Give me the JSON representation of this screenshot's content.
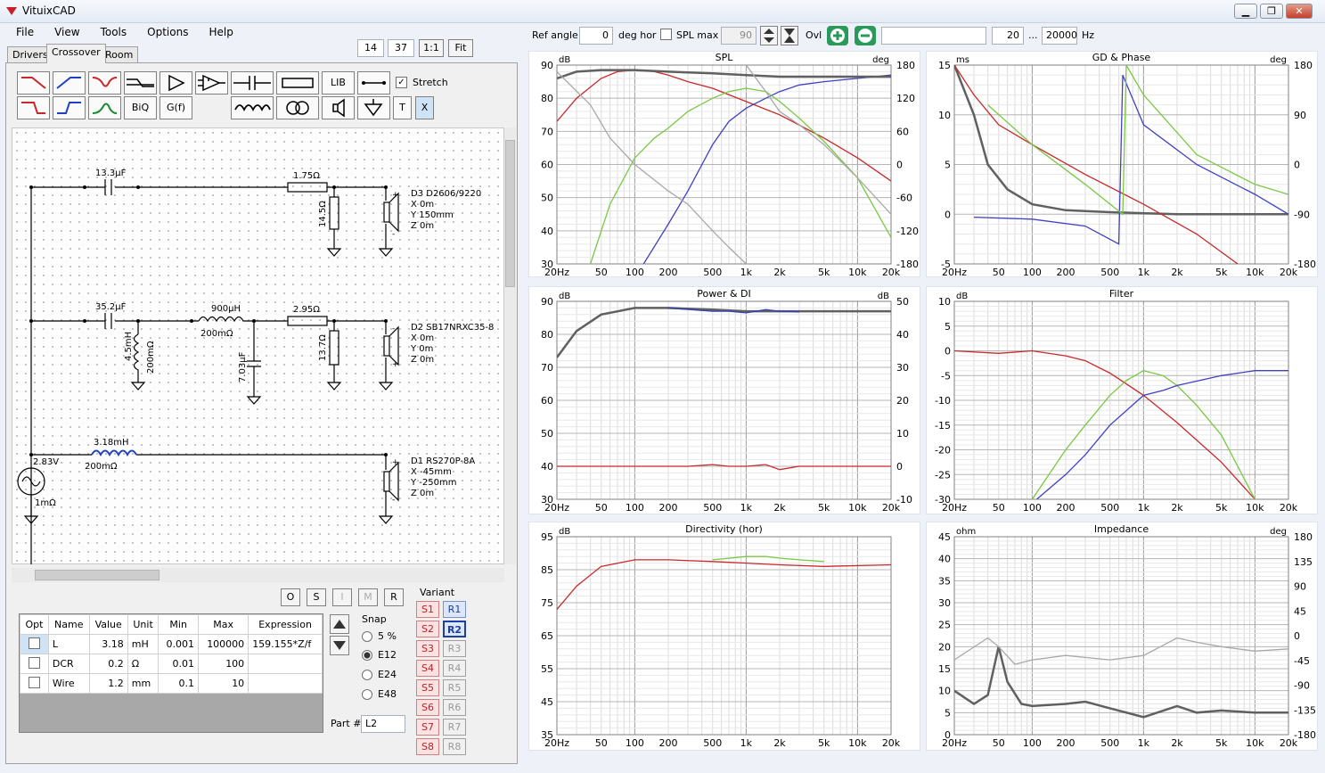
{
  "window": {
    "title": "VituixCAD",
    "minimize": "▁",
    "restore": "❐",
    "close": "✕"
  },
  "menu": [
    "File",
    "View",
    "Tools",
    "Options",
    "Help"
  ],
  "tabs": [
    "Drivers",
    "Crossover",
    "Room"
  ],
  "top_inputs": {
    "a": "14",
    "b": "37",
    "one_to_one": "1:1",
    "fit": "Fit"
  },
  "toolbar": {
    "lib": "LIB",
    "stretch": "Stretch",
    "biq": "BiQ",
    "gf": "G(f)",
    "t": "T",
    "x": "X"
  },
  "schematic": {
    "labels": {
      "c1": "13.3µF",
      "r1": "1.75Ω",
      "r2": "14.5Ω",
      "d3": "D3 D2606/9220",
      "d3x": "X 0m",
      "d3y": "Y 150mm",
      "d3z": "Z 0m",
      "c2": "35.2µF",
      "l1": "900µH",
      "l1r": "200mΩ",
      "r3": "2.95Ω",
      "l2": "4.5mH",
      "l2r": "200mΩ",
      "c3": "7.03µF",
      "r4": "13.7Ω",
      "d2": "D2 SB17NRXC35-8",
      "d2x": "X 0m",
      "d2y": "Y 0m",
      "d2z": "Z 0m",
      "l3": "3.18mH",
      "l3r": "200mΩ",
      "src": "2.83V",
      "srcr": "1mΩ",
      "d1": "D1 RS270P-8A",
      "d1x": "X -45mm",
      "d1y": "Y -250mm",
      "d1z": "Z 0m"
    }
  },
  "osimr": [
    "O",
    "S",
    "I",
    "M",
    "R"
  ],
  "params": {
    "headers": [
      "Opt",
      "Name",
      "Value",
      "Unit",
      "Min",
      "Max",
      "Expression"
    ],
    "rows": [
      {
        "name": "L",
        "value": "3.18",
        "unit": "mH",
        "min": "0.001",
        "max": "100000",
        "expr": "159.155*Z/f"
      },
      {
        "name": "DCR",
        "value": "0.2",
        "unit": "Ω",
        "min": "0.01",
        "max": "100",
        "expr": ""
      },
      {
        "name": "Wire",
        "value": "1.2",
        "unit": "mm",
        "min": "0.1",
        "max": "10",
        "expr": ""
      }
    ]
  },
  "snap": {
    "title": "Snap",
    "options": [
      "5 %",
      "E12",
      "E24",
      "E48"
    ],
    "selected": "E12",
    "part_label": "Part #",
    "part_value": "L2"
  },
  "variant": {
    "title": "Variant",
    "s": [
      "S1",
      "S2",
      "S3",
      "S4",
      "S5",
      "S6",
      "S7",
      "S8"
    ],
    "r": [
      "R1",
      "R2",
      "R3",
      "R4",
      "R5",
      "R6",
      "R7",
      "R8"
    ],
    "selected_r": "R2"
  },
  "topbar": {
    "ref_angle": "Ref angle",
    "ref_value": "0",
    "deg_hor": "deg hor",
    "spl_max": "SPL max",
    "spl_value": "90",
    "ovl": "Ovl",
    "f_lo": "20",
    "dots": "...",
    "f_hi": "20000",
    "hz": "Hz"
  },
  "chart_data": [
    {
      "type": "line",
      "title": "SPL",
      "ylabel": "dB",
      "y2label": "deg",
      "y_ticks": [
        "90",
        "80",
        "70",
        "60",
        "50",
        "40",
        "30"
      ],
      "y2_ticks": [
        "180",
        "120",
        "60",
        "0",
        "-60",
        "-120",
        "-180"
      ],
      "ylim": [
        30,
        90
      ],
      "xlim": [
        20,
        20000
      ],
      "xscale": "log",
      "series": [
        {
          "color": "#c8282a",
          "x": [
            20,
            30,
            50,
            70,
            100,
            150,
            200,
            300,
            500,
            1000,
            2000,
            5000,
            10000,
            20000
          ],
          "y": [
            73,
            80,
            86,
            88,
            88.5,
            88,
            87,
            85,
            83,
            79,
            75,
            68,
            62,
            55
          ]
        },
        {
          "color": "#4040c0",
          "x": [
            120,
            200,
            300,
            500,
            700,
            1000,
            1500,
            2000,
            3000,
            5000,
            10000,
            20000
          ],
          "y": [
            30,
            42,
            52,
            66,
            73,
            77,
            80,
            82,
            84,
            85,
            86,
            87
          ]
        },
        {
          "color": "#7ac843",
          "x": [
            40,
            60,
            100,
            150,
            200,
            300,
            500,
            700,
            1000,
            1500,
            2000,
            3000,
            5000,
            10000,
            20000
          ],
          "y": [
            30,
            48,
            62,
            68,
            71,
            76,
            80,
            82,
            83,
            82,
            79,
            74,
            67,
            56,
            38
          ]
        },
        {
          "color": "#606060",
          "x": [
            20,
            30,
            50,
            100,
            200,
            500,
            1000,
            2000,
            5000,
            10000,
            20000
          ],
          "y": [
            86,
            88,
            88.5,
            88.5,
            88,
            87.5,
            87,
            86.5,
            86.5,
            86.5,
            86.5
          ]
        },
        {
          "color": "#a8a8a8",
          "x": [
            20,
            40,
            60,
            100,
            200,
            300,
            500,
            700,
            1000
          ],
          "y": [
            88,
            78,
            68,
            60,
            52,
            48,
            40,
            35,
            30
          ]
        },
        {
          "color": "#a8a8a8",
          "x": [
            1000,
            1500,
            2000,
            3000,
            5000,
            10000,
            20000
          ],
          "y": [
            90,
            82,
            76,
            72,
            66,
            56,
            45
          ]
        }
      ]
    },
    {
      "type": "line",
      "title": "GD & Phase",
      "ylabel": "ms",
      "y2label": "deg",
      "y_ticks": [
        "15",
        "10",
        "5",
        "0",
        "-5"
      ],
      "y2_ticks": [
        "180",
        "90",
        "0",
        "-90",
        "-180"
      ],
      "ylim": [
        -5,
        15
      ],
      "xlim": [
        20,
        20000
      ],
      "xscale": "log",
      "series": [
        {
          "color": "#606060",
          "x": [
            20,
            30,
            40,
            60,
            100,
            200,
            500,
            1000,
            2000,
            5000,
            20000
          ],
          "y": [
            15,
            10,
            5,
            2.5,
            1,
            0.4,
            0.2,
            0.1,
            0,
            0,
            0
          ]
        },
        {
          "color": "#c8282a",
          "x": [
            20,
            30,
            50,
            100,
            300,
            1000,
            3000,
            7000
          ],
          "y": [
            15,
            12,
            9,
            7,
            4,
            1,
            -2,
            -5
          ]
        },
        {
          "color": "#4040c0",
          "x": [
            30,
            100,
            300,
            600,
            650,
            1000,
            3000,
            10000,
            20000
          ],
          "y": [
            -0.3,
            -0.5,
            -1.2,
            -3,
            14,
            9,
            5,
            2,
            0
          ]
        },
        {
          "color": "#7ac843",
          "x": [
            40,
            100,
            300,
            650,
            700,
            1000,
            3000,
            10000,
            20000
          ],
          "y": [
            11,
            7,
            3,
            0,
            15,
            12,
            6,
            3,
            2
          ]
        }
      ]
    },
    {
      "type": "line",
      "title": "Power & DI",
      "ylabel": "dB",
      "y2label": "dB",
      "y_ticks": [
        "90",
        "80",
        "70",
        "60",
        "50",
        "40",
        "30"
      ],
      "y2_ticks": [
        "50",
        "40",
        "30",
        "20",
        "10",
        "0",
        "-10"
      ],
      "ylim": [
        30,
        90
      ],
      "xlim": [
        20,
        20000
      ],
      "xscale": "log",
      "series": [
        {
          "color": "#606060",
          "x": [
            20,
            30,
            50,
            100,
            200,
            500,
            1000,
            2000,
            5000,
            20000
          ],
          "y": [
            73,
            81,
            86,
            88,
            88,
            87.5,
            87,
            87,
            87,
            87
          ]
        },
        {
          "color": "#3040b8",
          "x": [
            200,
            500,
            700,
            1000,
            1500,
            2000,
            3000
          ],
          "y": [
            88,
            87,
            87,
            86.5,
            87.5,
            87,
            86.8
          ]
        },
        {
          "color": "#c8282a",
          "x": [
            20,
            100,
            300,
            500,
            700,
            1000,
            1500,
            2000,
            3000,
            5000,
            10000,
            20000
          ],
          "y": [
            40,
            40,
            40,
            40.5,
            40,
            40,
            40.5,
            39,
            40,
            40,
            40,
            40
          ]
        }
      ]
    },
    {
      "type": "line",
      "title": "Filter",
      "ylabel": "dB",
      "y_ticks": [
        "10",
        "5",
        "0",
        "-5",
        "-10",
        "-15",
        "-20",
        "-25",
        "-30"
      ],
      "ylim": [
        -30,
        10
      ],
      "xlim": [
        20,
        20000
      ],
      "xscale": "log",
      "series": [
        {
          "color": "#c8282a",
          "x": [
            20,
            50,
            100,
            200,
            300,
            500,
            1000,
            2000,
            5000,
            10000
          ],
          "y": [
            0,
            -0.5,
            0,
            -1,
            -2,
            -4.5,
            -9,
            -14.5,
            -22.5,
            -30
          ]
        },
        {
          "color": "#7ac843",
          "x": [
            100,
            200,
            300,
            500,
            700,
            1000,
            1500,
            2000,
            3000,
            5000,
            10000
          ],
          "y": [
            -30,
            -20,
            -15,
            -9,
            -6,
            -4,
            -5,
            -7,
            -11,
            -17,
            -30
          ]
        },
        {
          "color": "#4040c0",
          "x": [
            110,
            200,
            300,
            500,
            1000,
            1500,
            2000,
            5000,
            10000,
            20000
          ],
          "y": [
            -30,
            -25,
            -21,
            -15,
            -9,
            -8,
            -7,
            -5,
            -4,
            -4
          ]
        }
      ]
    },
    {
      "type": "line",
      "title": "Directivity (hor)",
      "ylabel": "dB",
      "y_ticks": [
        "95",
        "85",
        "75",
        "65",
        "55",
        "45",
        "35"
      ],
      "ylim": [
        35,
        95
      ],
      "xlim": [
        20,
        20000
      ],
      "xscale": "log",
      "series": [
        {
          "color": "#c8282a",
          "x": [
            20,
            30,
            50,
            100,
            200,
            500,
            1000,
            2000,
            5000,
            20000
          ],
          "y": [
            73,
            80,
            86,
            88,
            88,
            87.5,
            87,
            86.5,
            86,
            86.5
          ]
        },
        {
          "color": "#7ac843",
          "x": [
            500,
            1000,
            1500,
            2000,
            3000,
            5000
          ],
          "y": [
            88,
            89,
            89,
            88.5,
            88,
            87.5
          ]
        }
      ]
    },
    {
      "type": "line",
      "title": "Impedance",
      "ylabel": "ohm",
      "y2label": "deg",
      "y_ticks": [
        "45",
        "40",
        "35",
        "30",
        "25",
        "20",
        "15",
        "10",
        "5",
        "0"
      ],
      "y2_ticks": [
        "180",
        "135",
        "90",
        "45",
        "0",
        "-45",
        "-90",
        "-135",
        "-180"
      ],
      "ylim": [
        0,
        45
      ],
      "xlim": [
        20,
        20000
      ],
      "xscale": "log",
      "series": [
        {
          "color": "#606060",
          "x": [
            20,
            30,
            40,
            50,
            60,
            80,
            100,
            200,
            300,
            500,
            1000,
            2000,
            3000,
            5000,
            10000,
            20000
          ],
          "y": [
            10,
            7,
            9,
            20,
            12,
            7,
            6.5,
            7,
            7.5,
            6,
            4,
            6.5,
            5,
            5.5,
            5,
            5
          ]
        },
        {
          "color": "#a8a8a8",
          "x": [
            20,
            40,
            50,
            70,
            100,
            200,
            500,
            1000,
            2000,
            3000,
            5000,
            10000,
            20000
          ],
          "y": [
            17,
            22,
            20,
            16,
            17,
            18,
            17,
            18,
            22,
            21,
            20,
            19,
            19.5
          ]
        }
      ]
    }
  ],
  "x_ticks": [
    "20Hz",
    "50",
    "100",
    "200",
    "500",
    "1k",
    "2k",
    "5k",
    "10k",
    "20k"
  ]
}
